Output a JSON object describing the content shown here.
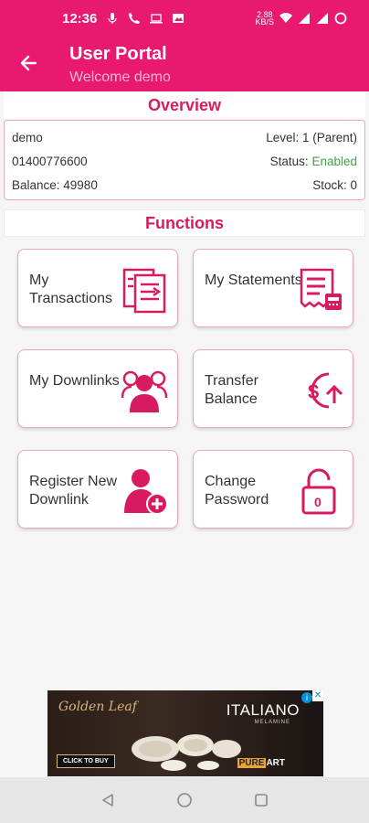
{
  "colors": {
    "primary": "#e8196e",
    "accent": "#d81b60",
    "success": "#43a047"
  },
  "status_bar": {
    "time": "12:36",
    "network_speed": "2.88\nKB/S"
  },
  "header": {
    "title": "User Portal",
    "subtitle": "Welcome demo",
    "back_icon": "arrow-left-icon"
  },
  "overview": {
    "heading": "Overview",
    "username": "demo",
    "level": "Level: 1 (Parent)",
    "phone": "01400776600",
    "status_label": "Status:",
    "status_value": "Enabled",
    "balance": "Balance: 49980",
    "stock": "Stock: 0"
  },
  "functions": {
    "heading": "Functions",
    "tiles": [
      {
        "label": "My Transactions",
        "icon": "transactions-icon"
      },
      {
        "label": "My Statements",
        "icon": "statement-receipt-icon"
      },
      {
        "label": "My Downlinks",
        "icon": "group-users-icon"
      },
      {
        "label": "Transfer Balance",
        "icon": "dollar-transfer-icon"
      },
      {
        "label": "Register New Downlink",
        "icon": "add-user-icon"
      },
      {
        "label": "Change Password",
        "icon": "padlock-icon"
      }
    ]
  },
  "ad": {
    "brand": "Golden Leaf",
    "product": "ITALIANO",
    "product_sub": "MELAMINE",
    "cta": "CLICK TO BUY",
    "pure": "PURE",
    "art": "ART"
  },
  "nav": {
    "back": "nav-back-icon",
    "home": "nav-home-icon",
    "recents": "nav-recents-icon"
  }
}
